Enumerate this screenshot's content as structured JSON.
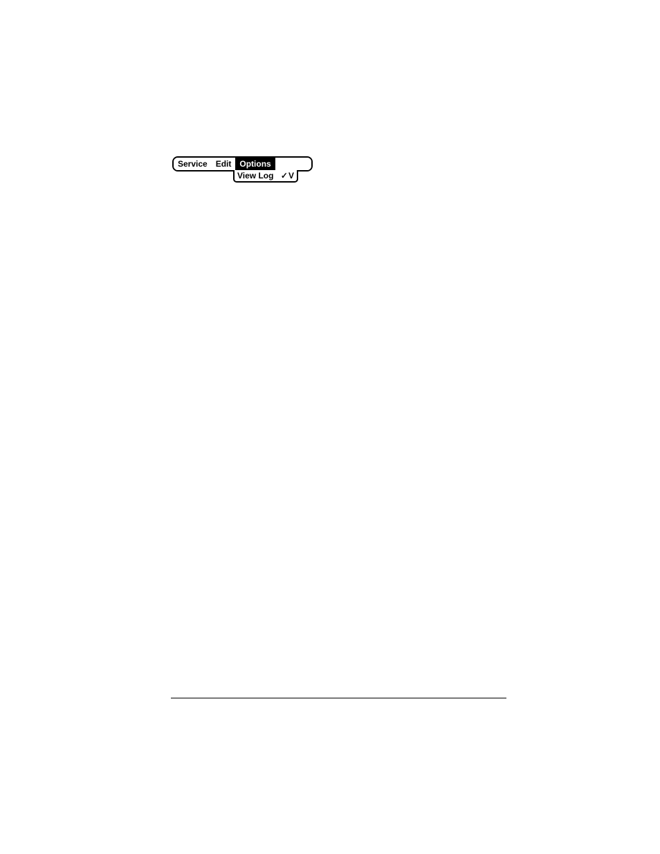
{
  "menubar": {
    "items": [
      {
        "label": "Service",
        "selected": false
      },
      {
        "label": "Edit",
        "selected": false
      },
      {
        "label": "Options",
        "selected": true
      }
    ]
  },
  "dropdown": {
    "items": [
      {
        "label": "View Log",
        "shortcut": "V"
      }
    ]
  }
}
